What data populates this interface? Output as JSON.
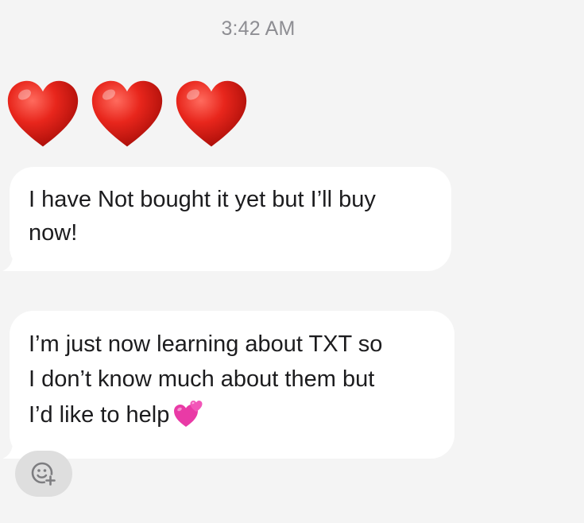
{
  "conversation": {
    "timestamp": "3:42 AM",
    "messages": [
      {
        "type": "emoji",
        "emoji": [
          "red-heart-icon",
          "red-heart-icon",
          "red-heart-icon"
        ]
      },
      {
        "type": "text",
        "text": "I have Not bought it yet but I’ll buy\nnow!"
      },
      {
        "type": "text",
        "text": "I’m just now learning about TXT so\nI don’t know much about them but\nI’d like to help",
        "trailing_emoji": "two-hearts-icon"
      }
    ]
  },
  "actions": {
    "add_reaction_icon": "add-reaction-icon"
  },
  "colors": {
    "background": "#f4f4f4",
    "bubble": "#ffffff",
    "timestamp": "#8e8e93",
    "heart": "#e0241b",
    "pink_hearts": "#e93aa6",
    "reaction_button": "#dedede"
  }
}
